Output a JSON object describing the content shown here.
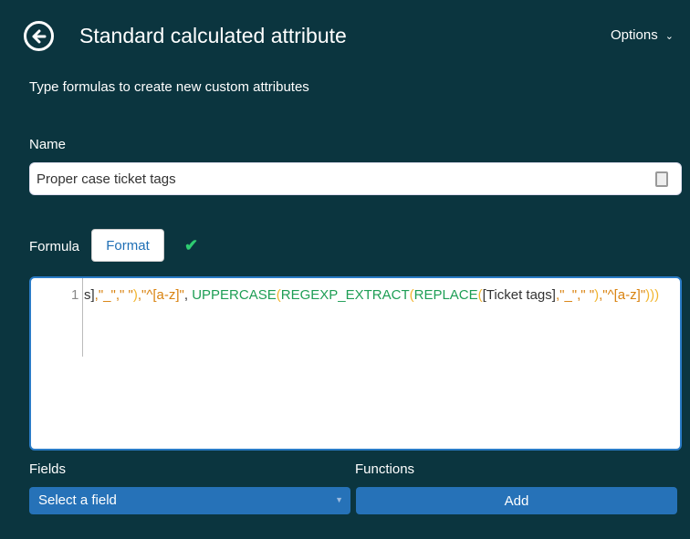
{
  "header": {
    "title": "Standard calculated attribute",
    "options_label": "Options",
    "back_icon": "arrow-left-circle-icon"
  },
  "subtitle": "Type formulas to create new custom attributes",
  "name": {
    "label": "Name",
    "value": "Proper case ticket tags"
  },
  "formula": {
    "label": "Formula",
    "format_label": "Format",
    "valid_icon": "✔",
    "line_number": "1",
    "tokens": [
      {
        "c": "t",
        "v": "s]"
      },
      {
        "c": "s",
        "v": ",\"_\",\" \""
      },
      {
        "c": "p",
        "v": ")"
      },
      {
        "c": "s",
        "v": ",\"^[a-z]\""
      },
      {
        "c": "t",
        "v": ", "
      },
      {
        "c": "f",
        "v": "UPPERCASE"
      },
      {
        "c": "p",
        "v": "("
      },
      {
        "c": "f",
        "v": "REGEXP_EXTRACT"
      },
      {
        "c": "p",
        "v": "("
      },
      {
        "c": "f",
        "v": "REPLACE"
      },
      {
        "c": "p",
        "v": "("
      },
      {
        "c": "t",
        "v": "[Ticket tags]"
      },
      {
        "c": "s",
        "v": ",\"_\",\" \""
      },
      {
        "c": "p",
        "v": ")"
      },
      {
        "c": "s",
        "v": ",\"^[a-z]\""
      },
      {
        "c": "p",
        "v": ")))"
      }
    ]
  },
  "fields": {
    "label": "Fields",
    "placeholder": "Select a field"
  },
  "functions": {
    "label": "Functions",
    "add_label": "Add"
  },
  "colors": {
    "background": "#0b353f",
    "button": "#2672b8",
    "string": "#d9820f",
    "function": "#1e9e55",
    "paren": "#f2b630"
  }
}
